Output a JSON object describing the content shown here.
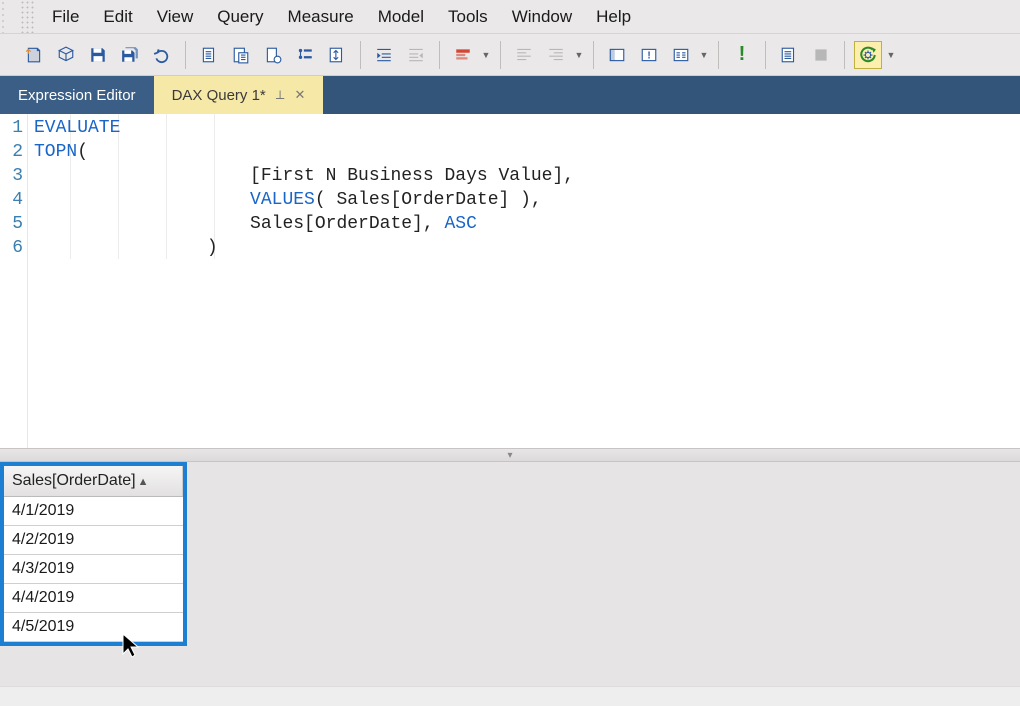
{
  "menu": [
    "File",
    "Edit",
    "View",
    "Query",
    "Measure",
    "Model",
    "Tools",
    "Window",
    "Help"
  ],
  "toolbar_icons": [
    "new-query-icon",
    "open-icon",
    "save-icon",
    "save-all-icon",
    "undo-icon",
    "SEP",
    "copy-icon",
    "paste-icon",
    "paste-special-icon",
    "format-icon",
    "swap-icon",
    "SEP",
    "indent-icon",
    "outdent-icon",
    "SEP",
    "DD",
    "highlight-icon",
    "SEP",
    "DD",
    "align-left-icon",
    "align-right-icon",
    "SEP",
    "DD",
    "panel-icon",
    "alert-icon",
    "options-icon",
    "SEP",
    "DD",
    "check-icon",
    "SEP",
    "list-icon",
    "stop-icon",
    "SEP",
    "run-gear-icon",
    "DD"
  ],
  "tabs": {
    "inactive": "Expression Editor",
    "active": "DAX Query 1*"
  },
  "code": {
    "lines": [
      "1",
      "2",
      "3",
      "4",
      "5",
      "6"
    ],
    "l1_kw": "EVALUATE",
    "l2_kw": "TOPN",
    "l2_rest": "(",
    "l3": "                    [First N Business Days Value],",
    "l4_pad": "                    ",
    "l4_kw": "VALUES",
    "l4_rest": "( Sales[OrderDate] ),",
    "l5_pad": "                    Sales[OrderDate], ",
    "l5_kw": "ASC",
    "l6": "                )"
  },
  "results": {
    "header": "Sales[OrderDate]",
    "rows": [
      "4/1/2019",
      "4/2/2019",
      "4/3/2019",
      "4/4/2019",
      "4/5/2019"
    ]
  }
}
